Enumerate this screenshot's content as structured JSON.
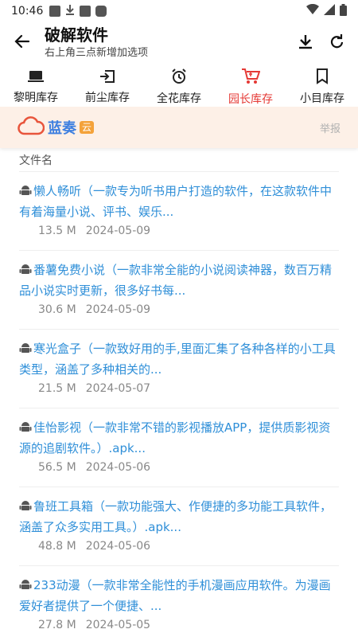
{
  "status_bar": {
    "time": "10:46"
  },
  "app_bar": {
    "title": "破解软件",
    "subtitle": "右上角三点新增加选项"
  },
  "tabs": [
    {
      "label": "黎明库存",
      "icon": "laptop-icon",
      "active": false
    },
    {
      "label": "前尘库存",
      "icon": "enter-box-icon",
      "active": false
    },
    {
      "label": "全花库存",
      "icon": "alarm-clock-icon",
      "active": false
    },
    {
      "label": "园长库存",
      "icon": "cart-icon",
      "active": true
    },
    {
      "label": "小目库存",
      "icon": "bookmark-icon",
      "active": false
    }
  ],
  "brand": {
    "name": "蓝奏",
    "badge": "云",
    "report": "举报"
  },
  "list": {
    "header": "文件名",
    "items": [
      {
        "title": "懒人畅听（一款专为听书用户打造的软件，在这款软件中有着海量小说、评书、娱乐...",
        "size": "13.5 M",
        "date": "2024-05-09"
      },
      {
        "title": "番薯免费小说（一款非常全能的小说阅读神器，数百万精品小说实时更新，很多好书每...",
        "size": "30.6 M",
        "date": "2024-05-09"
      },
      {
        "title": "寒光盒子（一款致好用的手,里面汇集了各种各样的小工具类型，涵盖了多种相关的...",
        "size": "21.5 M",
        "date": "2024-05-07"
      },
      {
        "title": "佳怡影视（一款非常不错的影视播放APP，提供质影视资源的追剧软件。）.apk...",
        "size": "56.5 M",
        "date": "2024-05-06"
      },
      {
        "title": "鲁班工具箱（一款功能强大、作便捷的多功能工具软件，涵盖了众多实用工具。）.apk...",
        "size": "48.8 M",
        "date": "2024-05-06"
      },
      {
        "title": "233动漫（一款非常全能性的手机漫画应用软件。为漫画爱好者提供了一个便捷、...",
        "size": "27.8 M",
        "date": "2024-05-05"
      }
    ]
  },
  "colors": {
    "accent_red": "#e53935",
    "link_blue": "#2f8fd8",
    "brand_bg": "#fdf0e7"
  }
}
